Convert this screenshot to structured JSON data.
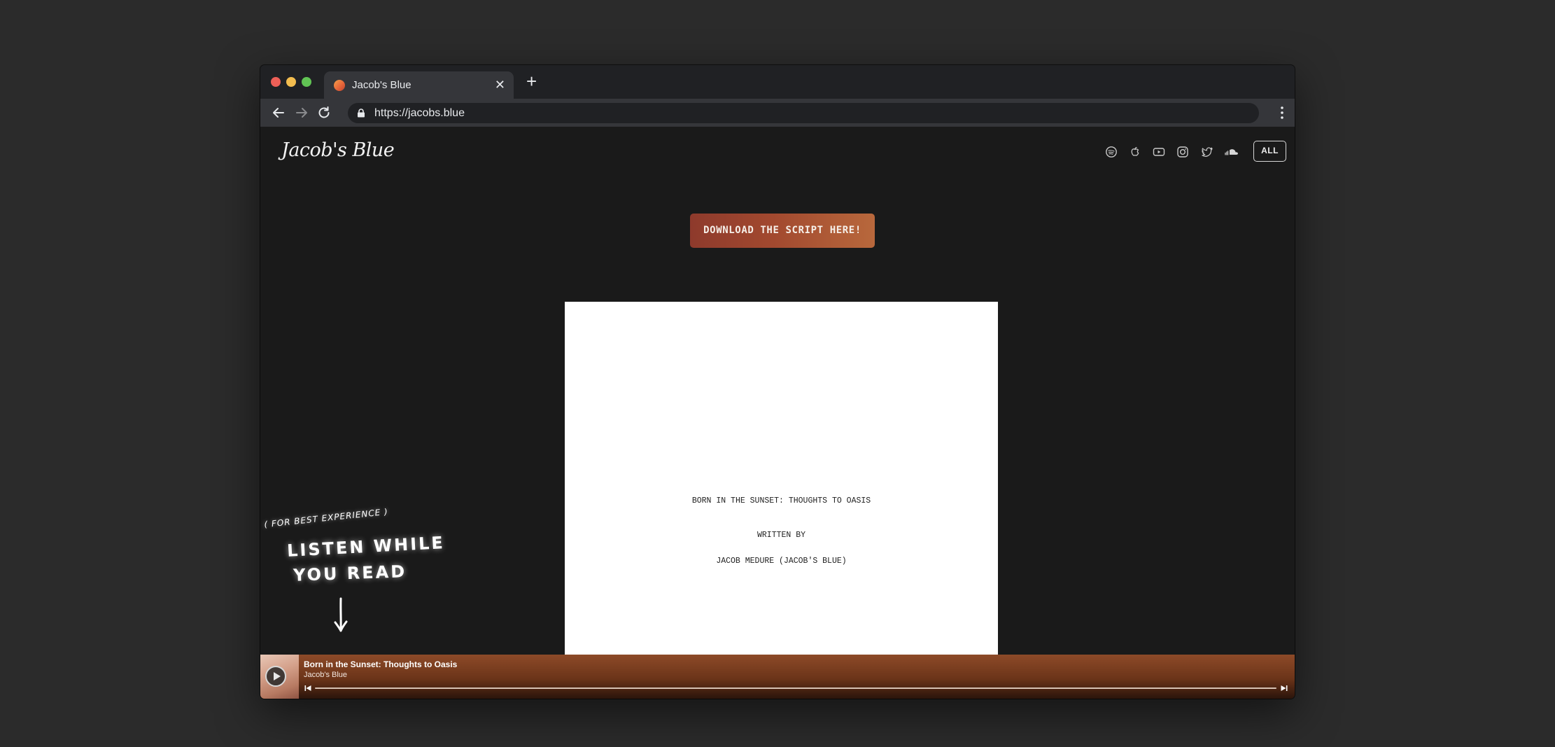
{
  "browser": {
    "tab_title": "Jacob's Blue",
    "tab_close": "✕",
    "new_tab": "+",
    "url": "https://jacobs.blue"
  },
  "site": {
    "logo_text": "Jacob's Blue",
    "social_icons": [
      "spotify-icon",
      "apple-music-icon",
      "youtube-icon",
      "instagram-icon",
      "twitter-icon",
      "soundcloud-icon"
    ],
    "all_button": "ALL",
    "download_button": "DOWNLOAD THE SCRIPT HERE!",
    "accent_gradient": [
      "#8e3a2c",
      "#b8683c"
    ]
  },
  "script": {
    "title": "BORN IN THE SUNSET: THOUGHTS TO OASIS",
    "written_by": "WRITTEN BY",
    "author": "JACOB MEDURE (JACOB'S BLUE)"
  },
  "hint": {
    "small": "( FOR BEST EXPERIENCE )",
    "line1": "LISTEN WHILE",
    "line2": "YOU READ"
  },
  "player": {
    "track_title": "Born in the Sunset: Thoughts to Oasis",
    "artist": "Jacob's Blue",
    "progress": 0
  }
}
